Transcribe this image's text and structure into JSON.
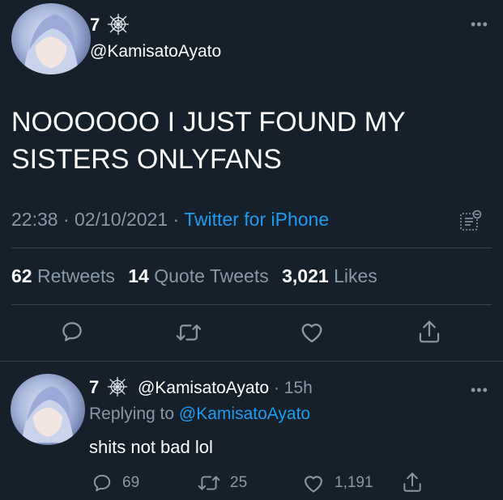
{
  "tweet": {
    "author_name": "7",
    "author_handle": "@KamisatoAyato",
    "text": "NOOOOOO I JUST FOUND MY SISTERS ONLYFANS",
    "time": "22:38",
    "date": "02/10/2021",
    "source": "Twitter for iPhone",
    "stats": {
      "retweets_count": "62",
      "retweets_label": "Retweets",
      "quotes_count": "14",
      "quotes_label": "Quote Tweets",
      "likes_count": "3,021",
      "likes_label": "Likes"
    }
  },
  "reply": {
    "author_name": "7",
    "author_handle": "@KamisatoAyato",
    "time_ago": "15h",
    "replying_prefix": "Replying to",
    "replying_handle": "@KamisatoAyato",
    "text": "shits not bad lol",
    "counts": {
      "replies": "69",
      "retweets": "25",
      "likes": "1,191"
    }
  },
  "icons": {
    "name_badge": "spider-web-icon",
    "more": "more-icon",
    "analytics": "analytics-icon",
    "reply": "reply-icon",
    "retweet": "retweet-icon",
    "like": "heart-icon",
    "share": "share-icon"
  },
  "colors": {
    "background": "#15202b",
    "text": "#ffffff",
    "muted": "#8899a6",
    "link": "#1d9bf0",
    "divider": "#38444d"
  }
}
